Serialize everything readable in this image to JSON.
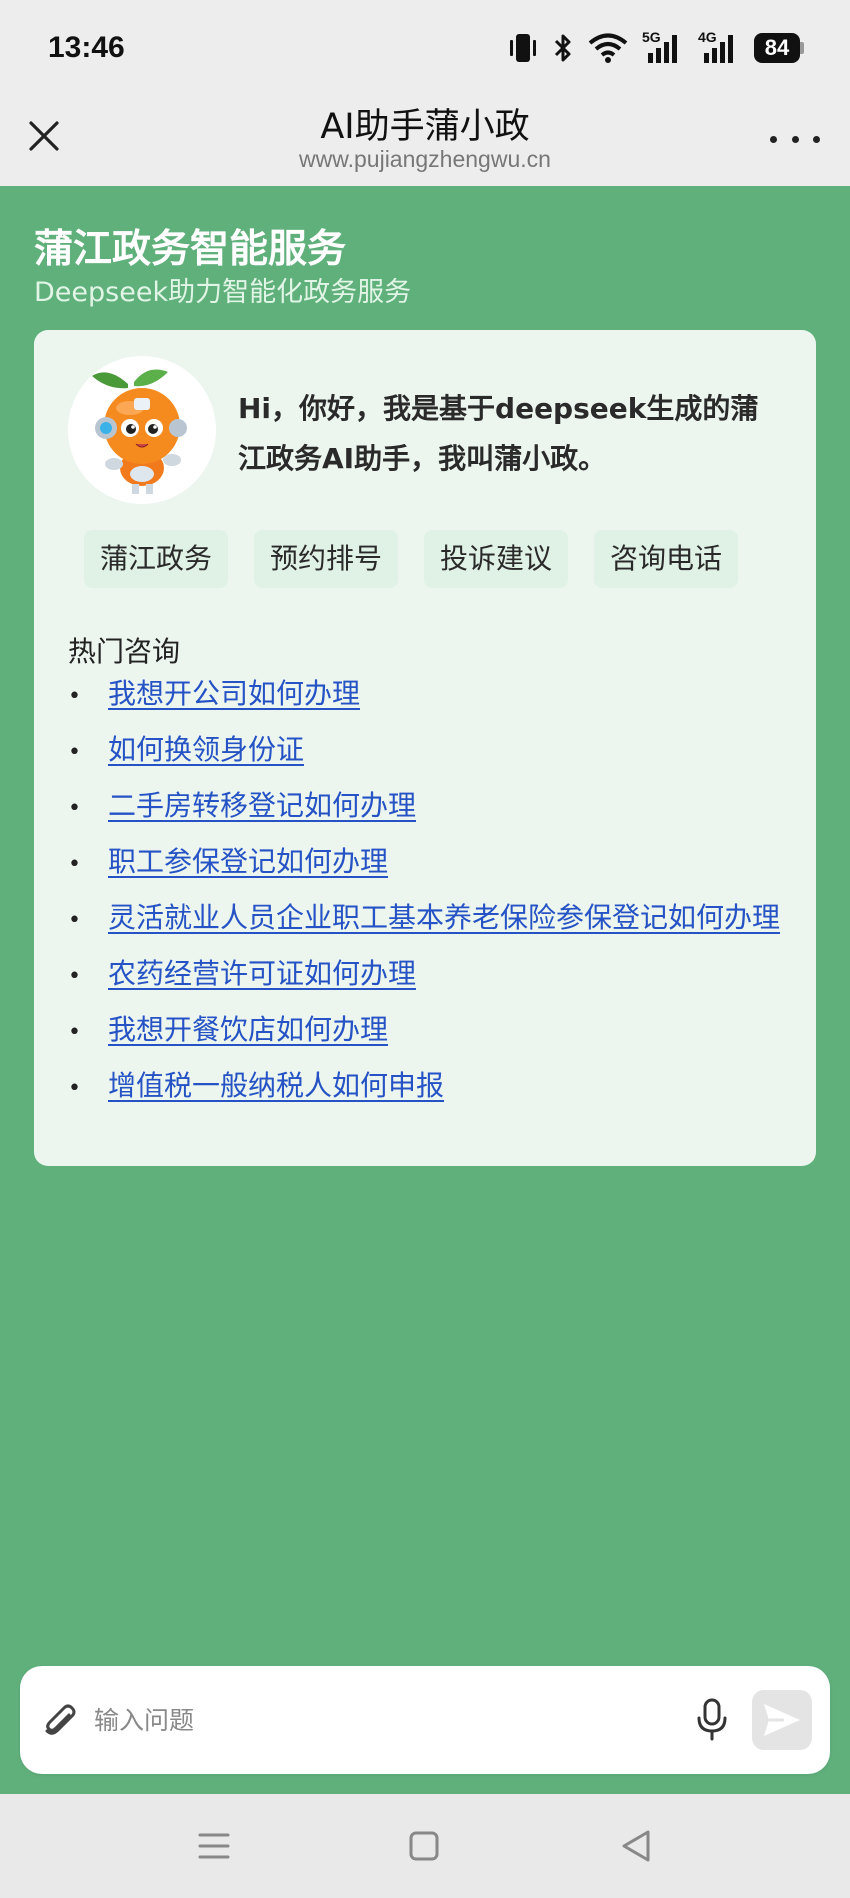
{
  "status_bar": {
    "time": "13:46",
    "battery": "84",
    "network_1": "5G",
    "network_2": "4G",
    "icons": [
      "vibrate-icon",
      "bluetooth-icon",
      "wifi-icon",
      "signal-5g-icon",
      "signal-4g-icon",
      "battery-icon"
    ]
  },
  "header": {
    "title": "AI助手蒲小政",
    "url": "www.pujiangzhengwu.cn",
    "close_icon": "close-icon",
    "more_icon": "more-icon"
  },
  "hero": {
    "title": "蒲江政务智能服务",
    "subtitle": "Deepseek助力智能化政务服务"
  },
  "card": {
    "greeting": "Hi，你好，我是基于deepseek生成的蒲江政务AI助手，我叫蒲小政。",
    "chips": [
      "蒲江政务",
      "预约排号",
      "投诉建议",
      "咨询电话"
    ],
    "hot_title": "热门咨询",
    "hot_items": [
      "我想开公司如何办理",
      "如何换领身份证",
      "二手房转移登记如何办理",
      "职工参保登记如何办理",
      "灵活就业人员企业职工基本养老保险参保登记如何办理",
      "农药经营许可证如何办理",
      "我想开餐饮店如何办理",
      "增值税一般纳税人如何申报"
    ]
  },
  "input": {
    "placeholder": "输入问题",
    "attach_icon": "paperclip-icon",
    "mic_icon": "microphone-icon",
    "send_icon": "send-icon"
  },
  "nav": {
    "icons": [
      "menu-icon",
      "home-square-icon",
      "back-triangle-icon"
    ]
  },
  "colors": {
    "main_bg": "#60b07c",
    "card_bg": "#ecf6ef",
    "chip_bg": "#e0f2e6",
    "link": "#2552c4"
  }
}
